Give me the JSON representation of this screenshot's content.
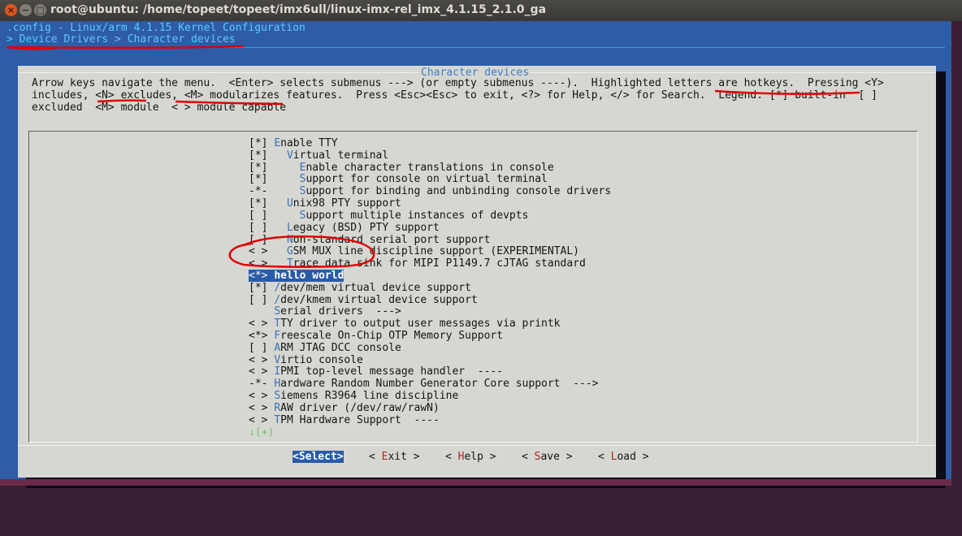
{
  "window": {
    "title": "root@ubuntu: /home/topeet/topeet/imx6ull/linux-imx-rel_imx_4.1.15_2.1.0_ga",
    "close_glyph": "×",
    "min_glyph": "−",
    "max_glyph": "□"
  },
  "header": {
    "config_line": ".config - Linux/arm 4.1.15 Kernel Configuration",
    "breadcrumb": "> Device Drivers > Character devices"
  },
  "dialog": {
    "title": "Character devices",
    "help_lines": [
      "Arrow keys navigate the menu.  <Enter> selects submenus ---> (or empty submenus ----).  Highlighted letters are hotkeys.  Pressing <Y>",
      "includes, <N> excludes, <M> modularizes features.  Press <Esc><Esc> to exit, <?> for Help, </> for Search.  Legend: [*] built-in  [ ]",
      "excluded  <M> module  < > module capable"
    ]
  },
  "menu": {
    "items": [
      {
        "prefix": "[*] ",
        "indent": "",
        "hk": "E",
        "rest": "nable TTY"
      },
      {
        "prefix": "[*] ",
        "indent": "  ",
        "hk": "V",
        "rest": "irtual terminal"
      },
      {
        "prefix": "[*] ",
        "indent": "    ",
        "hk": "E",
        "rest": "nable character translations in console"
      },
      {
        "prefix": "[*] ",
        "indent": "    ",
        "hk": "S",
        "rest": "upport for console on virtual terminal"
      },
      {
        "prefix": "-*- ",
        "indent": "    ",
        "hk": "S",
        "rest": "upport for binding and unbinding console drivers"
      },
      {
        "prefix": "[*] ",
        "indent": "  ",
        "hk": "U",
        "rest": "nix98 PTY support"
      },
      {
        "prefix": "[ ] ",
        "indent": "    ",
        "hk": "S",
        "rest": "upport multiple instances of devpts"
      },
      {
        "prefix": "[ ] ",
        "indent": "  ",
        "hk": "L",
        "rest": "egacy (BSD) PTY support"
      },
      {
        "prefix": "[ ] ",
        "indent": "  ",
        "hk": "N",
        "rest": "on-standard serial port support"
      },
      {
        "prefix": "< > ",
        "indent": "  ",
        "hk": "G",
        "rest": "SM MUX line discipline support (EXPERIMENTAL)"
      },
      {
        "prefix": "< > ",
        "indent": "  ",
        "hk": "T",
        "rest": "race data sink for MIPI P1149.7 cJTAG standard"
      },
      {
        "prefix": "<*> ",
        "indent": "",
        "hk": "h",
        "rest": "ello world"
      },
      {
        "prefix": "[*] ",
        "indent": "",
        "hk": "/",
        "rest": "dev/mem virtual device support"
      },
      {
        "prefix": "[ ] ",
        "indent": "",
        "hk": "/",
        "rest": "dev/kmem virtual device support"
      },
      {
        "prefix": "    ",
        "indent": "",
        "hk": "S",
        "rest": "erial drivers  --->"
      },
      {
        "prefix": "< > ",
        "indent": "",
        "hk": "T",
        "rest": "TY driver to output user messages via printk"
      },
      {
        "prefix": "<*> ",
        "indent": "",
        "hk": "F",
        "rest": "reescale On-Chip OTP Memory Support"
      },
      {
        "prefix": "[ ] ",
        "indent": "",
        "hk": "A",
        "rest": "RM JTAG DCC console"
      },
      {
        "prefix": "< > ",
        "indent": "",
        "hk": "V",
        "rest": "irtio console"
      },
      {
        "prefix": "< > ",
        "indent": "",
        "hk": "I",
        "rest": "PMI top-level message handler  ----"
      },
      {
        "prefix": "-*- ",
        "indent": "",
        "hk": "H",
        "rest": "ardware Random Number Generator Core support  --->"
      },
      {
        "prefix": "< > ",
        "indent": "",
        "hk": "S",
        "rest": "iemens R3964 line discipline"
      },
      {
        "prefix": "< > ",
        "indent": "",
        "hk": "R",
        "rest": "AW driver (/dev/raw/rawN)"
      },
      {
        "prefix": "< > ",
        "indent": "",
        "hk": "T",
        "rest": "PM Hardware Support  ----"
      }
    ],
    "selected_index": 11,
    "more_indicator": "↓(+)"
  },
  "buttons": {
    "select": {
      "pre": "<",
      "hk": "S",
      "post": "elect>"
    },
    "exit": {
      "pre": "< ",
      "hk": "E",
      "post": "xit >"
    },
    "help": {
      "pre": "< ",
      "hk": "H",
      "post": "elp >"
    },
    "save": {
      "pre": "< ",
      "hk": "S",
      "post": "ave >"
    },
    "load": {
      "pre": "< ",
      "hk": "L",
      "post": "oad >"
    }
  },
  "colors": {
    "terminal_bg": "#2e5ca6",
    "dialog_bg": "#d7d7d2",
    "highlight": "#2a5ba8",
    "annotation": "#e00000"
  }
}
